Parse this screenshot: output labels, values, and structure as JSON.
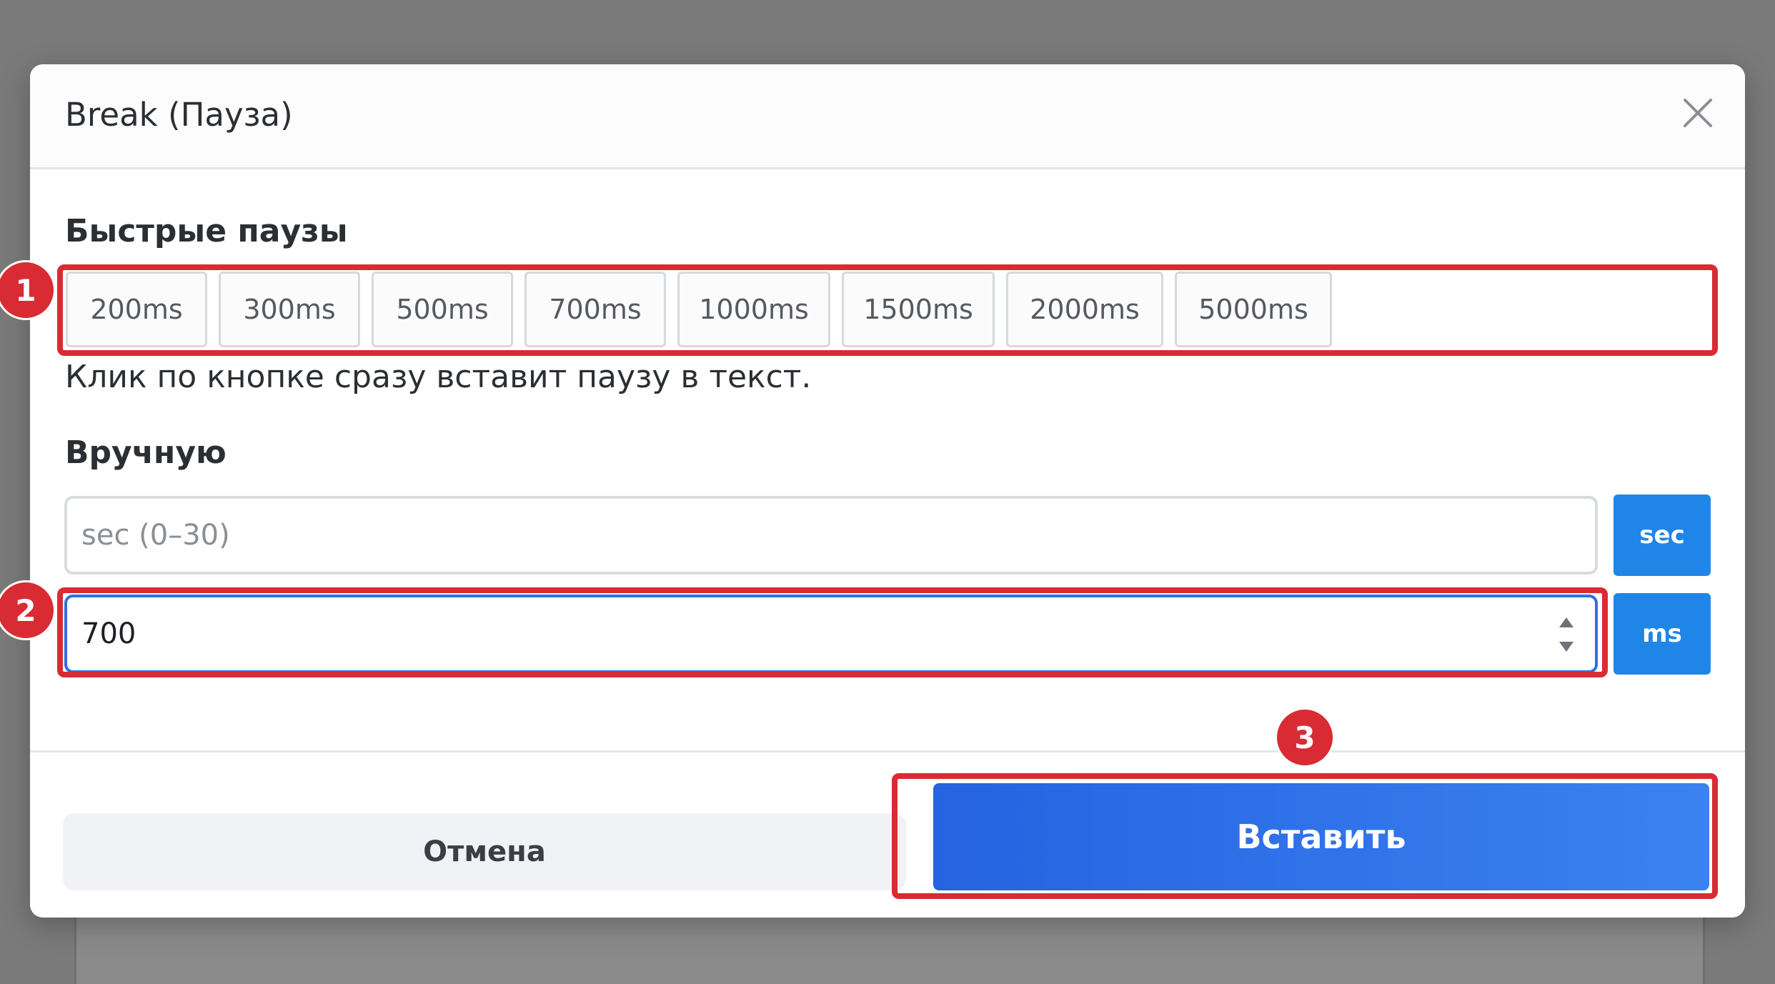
{
  "dialog": {
    "title": "Break (Пауза)",
    "close_icon": "close-icon"
  },
  "quick": {
    "title": "Быстрые паузы",
    "buttons": [
      "200ms",
      "300ms",
      "500ms",
      "700ms",
      "1000ms",
      "1500ms",
      "2000ms",
      "5000ms"
    ],
    "hint": "Клик по кнопке сразу вставит паузу в текст."
  },
  "manual": {
    "title": "Вручную",
    "sec_placeholder": "sec (0–30)",
    "sec_value": "",
    "sec_button": "sec",
    "ms_value": "700",
    "ms_button": "ms"
  },
  "footer": {
    "cancel_label": "Отмена",
    "insert_label": "Вставить"
  },
  "annotations": [
    "1",
    "2",
    "3"
  ],
  "colors": {
    "accent_blue": "#1f86e8",
    "insert_gradient_start": "#2563e0",
    "insert_gradient_end": "#3b82f1",
    "annotation_red": "#d92b33"
  }
}
